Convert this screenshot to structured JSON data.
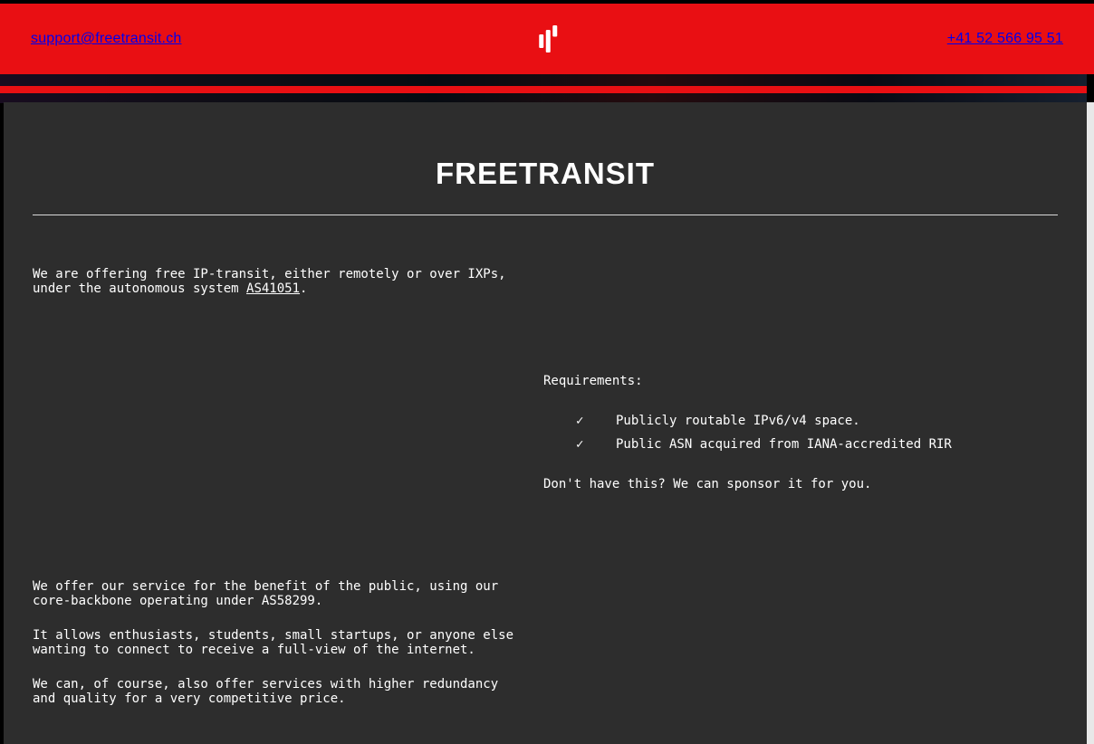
{
  "header": {
    "email": "support@freetransit.ch",
    "phone": "+41 52 566 95 51"
  },
  "title": "FREETRANSIT",
  "intro": {
    "text_before_link": "We are offering free IP-transit, either remotely or over IXPs, under the autonomous system ",
    "link_text": "AS41051",
    "text_after_link": "."
  },
  "requirements": {
    "label": "Requirements:",
    "items": [
      "Publicly routable IPv6/v4 space.",
      "Public ASN acquired from IANA-accredited RIR"
    ],
    "sponsor_text": "Don't have this? We can sponsor it for you."
  },
  "about": {
    "p1": "We offer our service for the benefit of the public, using our core-backbone operating under AS58299.",
    "p2": "It allows enthusiasts, students, small startups, or anyone else wanting to connect to receive a full-view of the internet.",
    "p3": "We can, of course, also offer services with higher redundancy and quality for a very competitive price."
  }
}
